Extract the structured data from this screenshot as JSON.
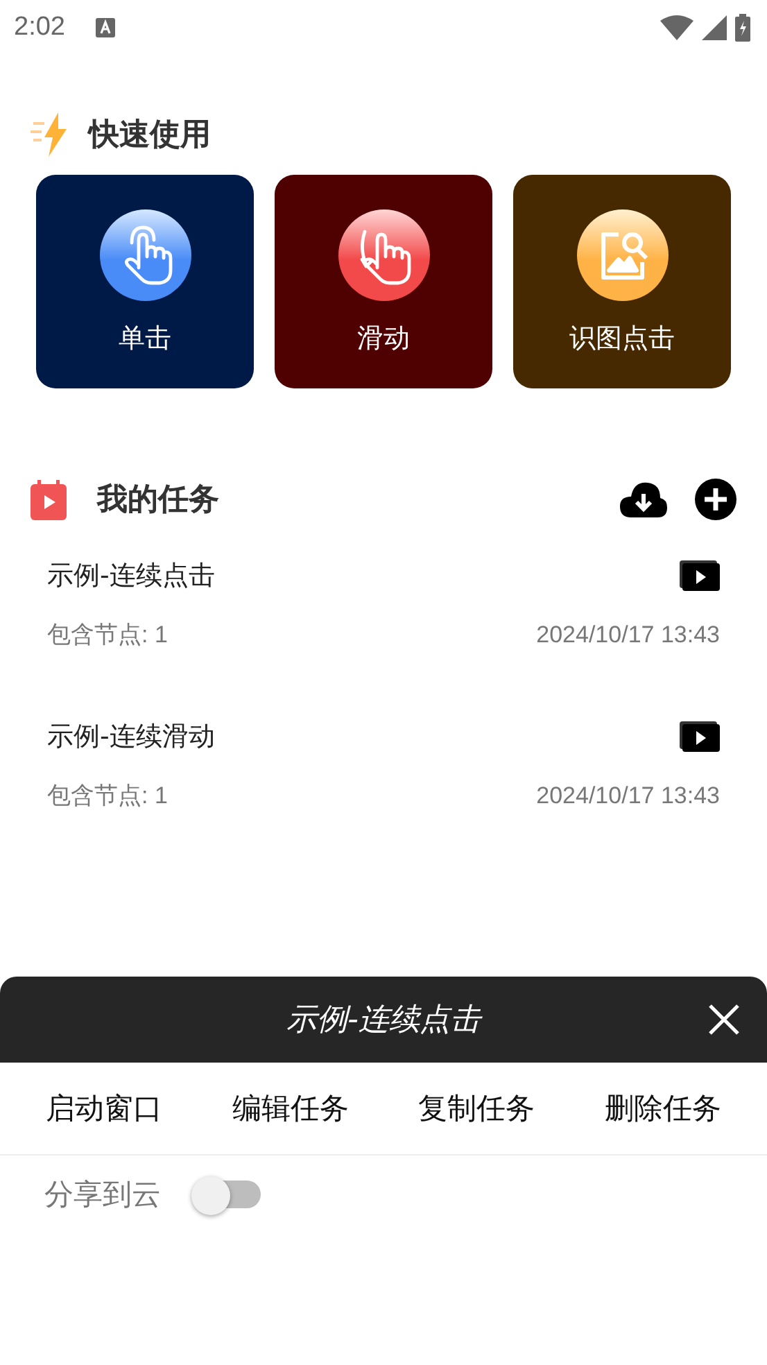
{
  "status_bar": {
    "time": "2:02"
  },
  "quick_use": {
    "title": "快速使用",
    "cards": [
      {
        "label": "单击",
        "kind": "tap",
        "color": "#001a47"
      },
      {
        "label": "滑动",
        "kind": "swipe",
        "color": "#4f0000"
      },
      {
        "label": "识图点击",
        "kind": "image",
        "color": "#472900"
      }
    ]
  },
  "tasks": {
    "title": "我的任务",
    "items": [
      {
        "name": "示例-连续点击",
        "nodes": "包含节点: 1",
        "time": "2024/10/17 13:43"
      },
      {
        "name": "示例-连续滑动",
        "nodes": "包含节点: 1",
        "time": "2024/10/17 13:43"
      }
    ]
  },
  "sheet": {
    "title": "示例-连续点击",
    "actions": [
      "启动窗口",
      "编辑任务",
      "复制任务",
      "删除任务"
    ],
    "share": {
      "label": "分享到云",
      "on": false
    }
  }
}
